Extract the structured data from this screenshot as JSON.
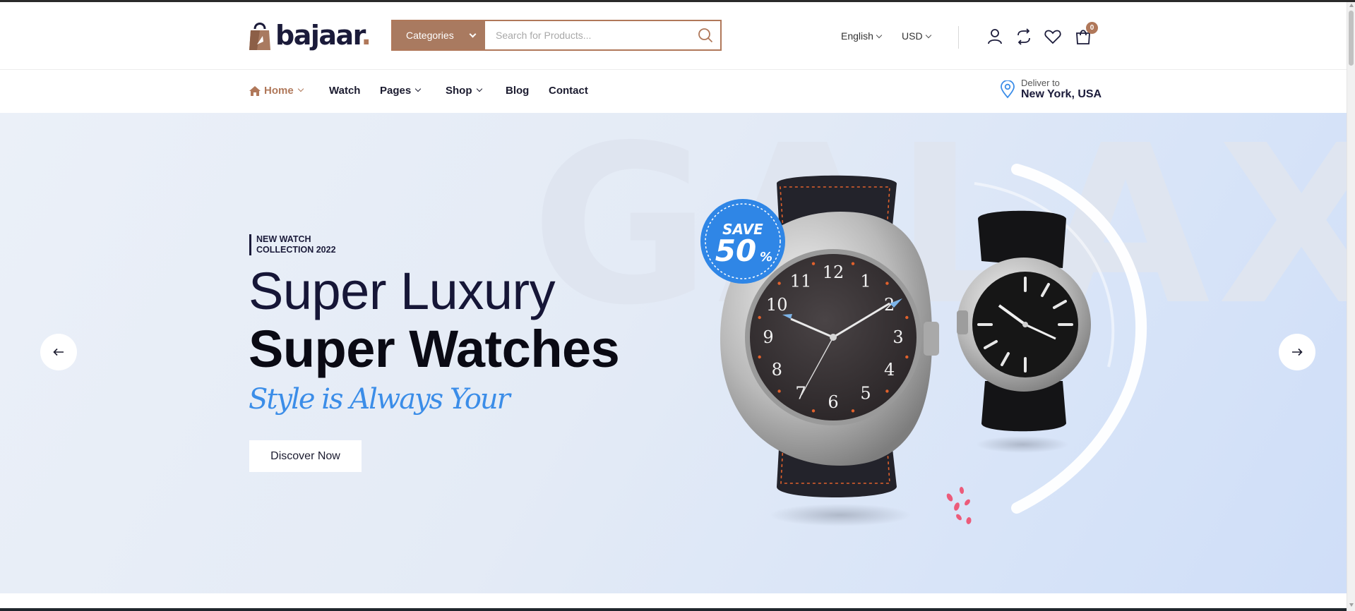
{
  "brand": {
    "name": "bajaar",
    "dot": ".",
    "accent": "#b0785a"
  },
  "search": {
    "category_label": "Categories",
    "placeholder": "Search for Products..."
  },
  "header": {
    "language": "English",
    "currency": "USD",
    "cart_count": "0"
  },
  "nav": {
    "items": [
      {
        "label": "Home",
        "active": true,
        "has_dropdown": true
      },
      {
        "label": "Watch"
      },
      {
        "label": "Pages",
        "has_dropdown": true
      },
      {
        "label": "Shop",
        "has_dropdown": true
      },
      {
        "label": "Blog"
      },
      {
        "label": "Contact"
      }
    ],
    "deliver_label": "Deliver to",
    "deliver_location": "New York, USA"
  },
  "hero": {
    "background_word": "GALAXY",
    "tag_line1": "NEW WATCH",
    "tag_line2": "COLLECTION 2022",
    "title_light": "Super Luxury",
    "title_bold": "Super Watches",
    "script_text": "Style is Always Your",
    "cta_label": "Discover Now",
    "badge_save": "SAVE",
    "badge_percent": "50",
    "badge_symbol": "%",
    "script_color": "#3b8de8",
    "badge_color": "#2f86e6"
  },
  "watch_dial_numbers": [
    "12",
    "1",
    "2",
    "3",
    "4",
    "5",
    "6",
    "7",
    "8",
    "9",
    "10",
    "11"
  ]
}
